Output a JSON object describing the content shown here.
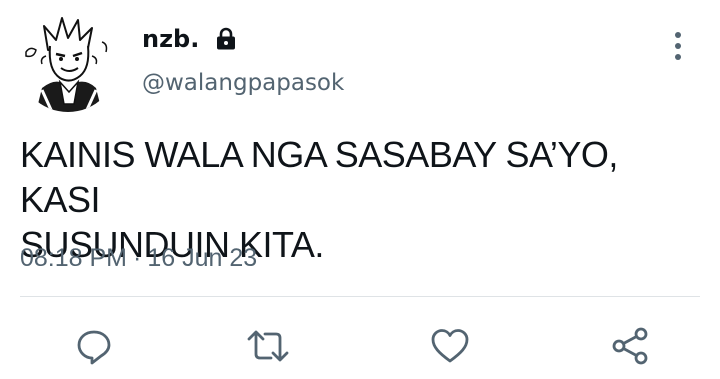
{
  "tweet": {
    "display_name": "nzb.",
    "handle": "@walangpapasok",
    "text": "KAINIS WALA NGA SASABAY SA’YO, KASI\nSUSUNDUIN KITA.",
    "time": "08:18 PM",
    "separator": "·",
    "date": "16 Jun 23"
  },
  "icons": {
    "avatar": "manga-character-avatar",
    "lock": "lock-icon",
    "more": "more-vertical-icon",
    "reply": "reply-icon",
    "retweet": "retweet-icon",
    "like": "like-heart-icon",
    "share": "share-icon"
  },
  "colors": {
    "text": "#0f1419",
    "secondary": "#536471",
    "divider": "#dfe3e6",
    "background": "#ffffff"
  }
}
